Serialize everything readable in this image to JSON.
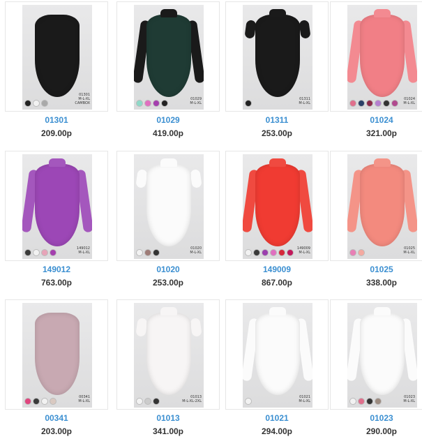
{
  "products": [
    {
      "code": "01301",
      "price": "209.00р",
      "tag": "01301\nM-L-XL\nCAMBOX",
      "body_color": "#1a1a1a",
      "sleeves": "none",
      "bg": "grey",
      "swatches": [
        "#222222",
        "#f2f2f2",
        "#a9a9a9"
      ]
    },
    {
      "code": "01029",
      "price": "419.00р",
      "tag": "01029\nM-L-XL",
      "body_color": "#1f3b34",
      "sleeves": "long",
      "sleeve_color": "#1a1a1a",
      "bg": "grey",
      "swatches": [
        "#8fd9c8",
        "#e06fc0",
        "#a43fae",
        "#222222"
      ]
    },
    {
      "code": "01311",
      "price": "253.00р",
      "tag": "01311\nM-L-XL",
      "body_color": "#1a1a1a",
      "sleeves": "short",
      "sleeve_color": "#1a1a1a",
      "bg": "grey",
      "swatches": [
        "#222222"
      ]
    },
    {
      "code": "01024",
      "price": "321.00р",
      "tag": "01024\nM-L-XL",
      "body_color": "#f17f86",
      "sleeves": "long",
      "sleeve_color": "#f38a91",
      "bg": "grey",
      "swatches": [
        "#e06f8c",
        "#2a3f66",
        "#8c2a4a",
        "#b57fd0",
        "#333333",
        "#b14a8f"
      ]
    },
    {
      "code": "149012",
      "price": "763.00р",
      "tag": "149012\nM-L-XL",
      "body_color": "#9c47b6",
      "sleeves": "long",
      "sleeve_color": "#a457bd",
      "bg": "grey",
      "swatches": [
        "#3a3a3a",
        "#f2f2f2",
        "#e7a4b8",
        "#a43fae"
      ]
    },
    {
      "code": "01020",
      "price": "253.00р",
      "tag": "01020\nM-L-XL",
      "body_color": "#fbfbfb",
      "sleeves": "short",
      "sleeve_color": "#fbfbfb",
      "bg": "grey",
      "swatches": [
        "#f2f2f2",
        "#9e7c77",
        "#333333"
      ]
    },
    {
      "code": "149009",
      "price": "867.00р",
      "tag": "149009\nM-L-XL",
      "body_color": "#f03b32",
      "sleeves": "long",
      "sleeve_color": "#f04a40",
      "bg": "grey",
      "swatches": [
        "#f2f2f2",
        "#3a3a3a",
        "#9b3fae",
        "#e06fc0",
        "#d6283a",
        "#c2185b"
      ]
    },
    {
      "code": "01025",
      "price": "338.00р",
      "tag": "01025\nM-L-XL",
      "body_color": "#f38a7e",
      "sleeves": "long",
      "sleeve_color": "#f49488",
      "bg": "grey",
      "swatches": [
        "#e87fb5",
        "#f4a9a0"
      ]
    },
    {
      "code": "00341",
      "price": "203.00р",
      "tag": "00341\nM-L-XL",
      "body_color": "#c8a9b2",
      "sleeves": "none",
      "bg": "grey",
      "swatches": [
        "#e0457e",
        "#3a3a3a",
        "#f2f2f2",
        "#d9c9c1"
      ]
    },
    {
      "code": "01013",
      "price": "341.00р",
      "tag": "01013\nM-L-XL-2XL",
      "body_color": "#f7f5f5",
      "sleeves": "short",
      "sleeve_color": "#f7f5f5",
      "bg": "grey",
      "swatches": [
        "#f2f2f2",
        "#cccccc",
        "#333333"
      ]
    },
    {
      "code": "01021",
      "price": "294.00р",
      "tag": "01021\nM-L-XL",
      "body_color": "#fbfbfb",
      "sleeves": "long",
      "sleeve_color": "#fbfbfb",
      "bg": "grey",
      "swatches": [
        "#f2f2f2"
      ]
    },
    {
      "code": "01023",
      "price": "290.00р",
      "tag": "01023\nM-L-XL",
      "body_color": "#fbfbfb",
      "sleeves": "long",
      "sleeve_color": "#fbfbfb",
      "bg": "grey",
      "swatches": [
        "#f2f2f2",
        "#e06f8c",
        "#333333",
        "#9c8b80"
      ]
    }
  ]
}
